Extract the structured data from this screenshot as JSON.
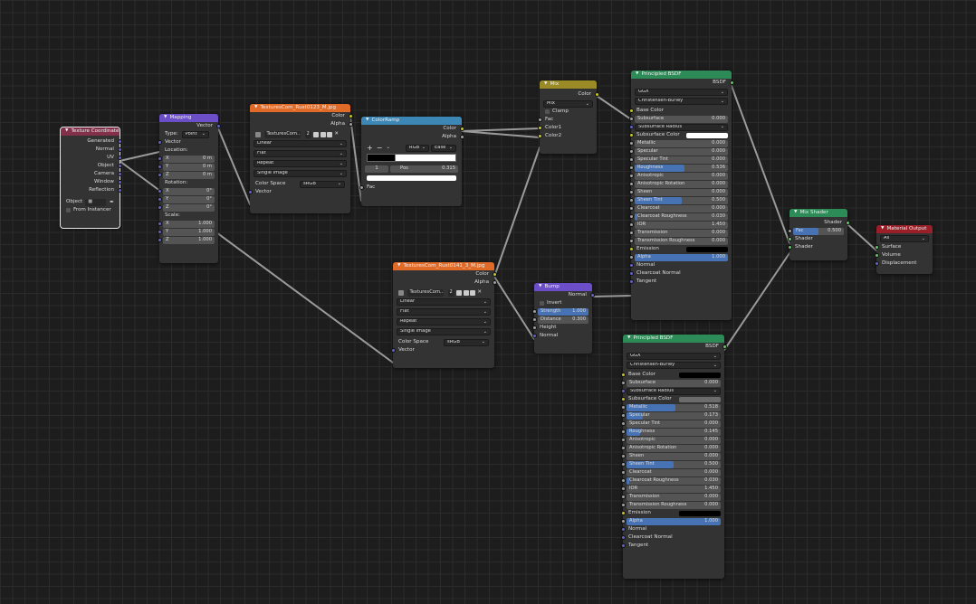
{
  "colors": {
    "background": "#1d1d1d",
    "input": "#83314a",
    "vector": "#6c4ec8",
    "texture": "#e06b28",
    "converter": "#3c87b6",
    "color": "#9b8b26",
    "shader": "#2d8b57",
    "output": "#9a1f28",
    "accent": "#4772b3"
  },
  "texcoord": {
    "title": "Texture Coordinate",
    "outputs": [
      "Generated",
      "Normal",
      "UV",
      "Object",
      "Camera",
      "Window",
      "Reflection"
    ],
    "object_label": "Object",
    "from_instancer": "From Instancer",
    "eyedropper_icon": "eyedropper-icon"
  },
  "mapping": {
    "title": "Mapping",
    "out_vector": "Vector",
    "type_label": "Type:",
    "type_value": "Point",
    "in_vector": "Vector",
    "location": "Location:",
    "loc": [
      {
        "a": "X",
        "v": "0 m"
      },
      {
        "a": "Y",
        "v": "0 m"
      },
      {
        "a": "Z",
        "v": "0 m"
      }
    ],
    "rotation": "Rotation:",
    "rot": [
      {
        "a": "X",
        "v": "0°"
      },
      {
        "a": "Y",
        "v": "0°"
      },
      {
        "a": "Z",
        "v": "0°"
      }
    ],
    "scale": "Scale:",
    "scl": [
      {
        "a": "X",
        "v": "1.000"
      },
      {
        "a": "Y",
        "v": "1.000"
      },
      {
        "a": "Z",
        "v": "1.000"
      }
    ]
  },
  "tex1": {
    "title": "TexturesCom_Rust0123_M.jpg",
    "out_color": "Color",
    "out_alpha": "Alpha",
    "image": "TexturesCom...",
    "users": "2",
    "interp": "Linear",
    "proj": "Flat",
    "ext": "Repeat",
    "source": "Single Image",
    "cs_label": "Color Space",
    "cs_value": "sRGB",
    "in_vector": "Vector"
  },
  "ramp": {
    "title": "ColorRamp",
    "out_color": "Color",
    "out_alpha": "Alpha",
    "mode": "RGB",
    "interp": "Ease",
    "index": "1",
    "pos_label": "Pos",
    "pos_value": "0.315",
    "in_fac": "Fac"
  },
  "tex2": {
    "title": "TexturesCom_Rust0141_3_M.jpg",
    "out_color": "Color",
    "out_alpha": "Alpha",
    "image": "TexturesCom...",
    "users": "2",
    "interp": "Linear",
    "proj": "Flat",
    "ext": "Repeat",
    "source": "Single Image",
    "cs_label": "Color Space",
    "cs_value": "sRGB",
    "in_vector": "Vector"
  },
  "mix": {
    "title": "Mix",
    "out_color": "Color",
    "blend": "Mix",
    "clamp": "Clamp",
    "in_fac": "Fac",
    "in_c1": "Color1",
    "in_c2": "Color2"
  },
  "bump": {
    "title": "Bump",
    "out_normal": "Normal",
    "invert": "Invert",
    "strength_label": "Strength",
    "strength_value": "1.000",
    "distance_label": "Distance",
    "distance_value": "0.300",
    "in_height": "Height",
    "in_normal": "Normal"
  },
  "bsdf1": {
    "title": "Principled BSDF",
    "out": "BSDF",
    "dist": "GGX",
    "sss_method": "Christensen-Burley",
    "base_color": "Base Color",
    "subsurface": "Subsurface",
    "subsurface_v": "0.000",
    "subsurface_radius": "Subsurface Radius",
    "subsurface_color": "Subsurface Color",
    "params": [
      {
        "l": "Metallic",
        "v": "0.000",
        "f": 0
      },
      {
        "l": "Specular",
        "v": "0.000",
        "f": 0
      },
      {
        "l": "Specular Tint",
        "v": "0.000",
        "f": 0
      },
      {
        "l": "Roughness",
        "v": "0.536",
        "f": 0.536
      },
      {
        "l": "Anisotropic",
        "v": "0.000",
        "f": 0
      },
      {
        "l": "Anisotropic Rotation",
        "v": "0.000",
        "f": 0
      },
      {
        "l": "Sheen",
        "v": "0.000",
        "f": 0
      },
      {
        "l": "Sheen Tint",
        "v": "0.500",
        "f": 0.5
      },
      {
        "l": "Clearcoat",
        "v": "0.000",
        "f": 0
      },
      {
        "l": "Clearcoat Roughness",
        "v": "0.030",
        "f": 0.03
      },
      {
        "l": "IOR",
        "v": "1.450",
        "f": 0
      },
      {
        "l": "Transmission",
        "v": "0.000",
        "f": 0
      },
      {
        "l": "Transmission Roughness",
        "v": "0.000",
        "f": 0
      }
    ],
    "emission": "Emission",
    "alpha": "Alpha",
    "alpha_v": "1.000",
    "normal": "Normal",
    "clearcoat_normal": "Clearcoat Normal",
    "tangent": "Tangent"
  },
  "bsdf2": {
    "title": "Principled BSDF",
    "out": "BSDF",
    "dist": "GGX",
    "sss_method": "Christensen-Burley",
    "base_color": "Base Color",
    "subsurface": "Subsurface",
    "subsurface_v": "0.000",
    "subsurface_radius": "Subsurface Radius",
    "subsurface_color": "Subsurface Color",
    "params": [
      {
        "l": "Metallic",
        "v": "0.518",
        "f": 0.518
      },
      {
        "l": "Specular",
        "v": "0.173",
        "f": 0.173
      },
      {
        "l": "Specular Tint",
        "v": "0.000",
        "f": 0
      },
      {
        "l": "Roughness",
        "v": "0.145",
        "f": 0.145
      },
      {
        "l": "Anisotropic",
        "v": "0.000",
        "f": 0
      },
      {
        "l": "Anisotropic Rotation",
        "v": "0.000",
        "f": 0
      },
      {
        "l": "Sheen",
        "v": "0.000",
        "f": 0
      },
      {
        "l": "Sheen Tint",
        "v": "0.500",
        "f": 0.5
      },
      {
        "l": "Clearcoat",
        "v": "0.000",
        "f": 0
      },
      {
        "l": "Clearcoat Roughness",
        "v": "0.030",
        "f": 0.03
      },
      {
        "l": "IOR",
        "v": "1.450",
        "f": 0
      },
      {
        "l": "Transmission",
        "v": "0.000",
        "f": 0
      },
      {
        "l": "Transmission Roughness",
        "v": "0.000",
        "f": 0
      }
    ],
    "emission": "Emission",
    "alpha": "Alpha",
    "alpha_v": "1.000",
    "normal": "Normal",
    "clearcoat_normal": "Clearcoat Normal",
    "tangent": "Tangent"
  },
  "mixshader": {
    "title": "Mix Shader",
    "out": "Shader",
    "fac_label": "Fac",
    "fac_value": "0.500",
    "in1": "Shader",
    "in2": "Shader"
  },
  "matout": {
    "title": "Material Output",
    "target": "All",
    "surface": "Surface",
    "volume": "Volume",
    "displacement": "Displacement"
  }
}
